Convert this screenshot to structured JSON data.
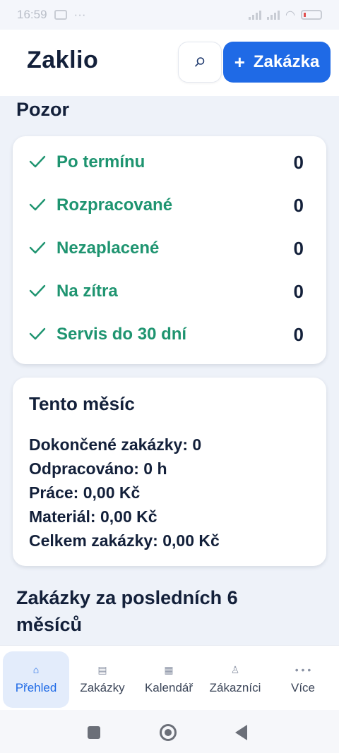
{
  "status": {
    "time": "16:59"
  },
  "header": {
    "title": "Zaklio",
    "add_button_plus": "+",
    "add_button_label": "Zakázka"
  },
  "alerts": {
    "title": "Pozor",
    "items": [
      {
        "label": "Po termínu",
        "count": "0"
      },
      {
        "label": "Rozpracované",
        "count": "0"
      },
      {
        "label": "Nezaplacené",
        "count": "0"
      },
      {
        "label": "Na zítra",
        "count": "0"
      },
      {
        "label": "Servis do 30 dní",
        "count": "0"
      }
    ]
  },
  "month": {
    "title": "Tento měsíc",
    "lines": [
      "Dokončené zakázky: 0",
      "Odpracováno: 0 h",
      "Práce: 0,00 Kč",
      "Materiál: 0,00 Kč",
      "Celkem zakázky: 0,00 Kč"
    ]
  },
  "chart_section": {
    "title": "Zakázky za posledních 6 měsíců"
  },
  "nav": {
    "items": [
      {
        "label": "Přehled",
        "icon": "home-icon",
        "glyph": "⌂"
      },
      {
        "label": "Zakázky",
        "icon": "list-icon",
        "glyph": "▤"
      },
      {
        "label": "Kalendář",
        "icon": "calendar-icon",
        "glyph": "▦"
      },
      {
        "label": "Zákazníci",
        "icon": "person-icon",
        "glyph": "♙"
      },
      {
        "label": "Více",
        "icon": "more-icon",
        "glyph": "• • •"
      }
    ]
  },
  "colors": {
    "accent": "#1f6ae6",
    "success": "#1e9470",
    "text": "#13203a",
    "background": "#eef2f9"
  }
}
